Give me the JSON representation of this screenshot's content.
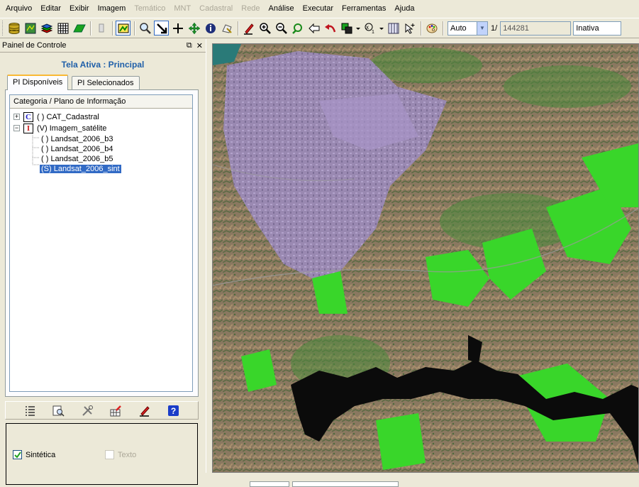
{
  "menu": {
    "items": [
      {
        "label": "Arquivo",
        "enabled": true
      },
      {
        "label": "Editar",
        "enabled": true
      },
      {
        "label": "Exibir",
        "enabled": true
      },
      {
        "label": "Imagem",
        "enabled": true
      },
      {
        "label": "Temático",
        "enabled": false
      },
      {
        "label": "MNT",
        "enabled": false
      },
      {
        "label": "Cadastral",
        "enabled": false
      },
      {
        "label": "Rede",
        "enabled": false
      },
      {
        "label": "Análise",
        "enabled": true
      },
      {
        "label": "Executar",
        "enabled": true
      },
      {
        "label": "Ferramentas",
        "enabled": true
      },
      {
        "label": "Ajuda",
        "enabled": true
      }
    ]
  },
  "toolbar": {
    "zoom_select_value": "Auto",
    "scale_prefix": "1/",
    "scale_value": "144281",
    "status_value": "Inativa"
  },
  "panel": {
    "title": "Painel de Controle",
    "active_screen": "Tela Ativa : Principal",
    "tabs": [
      "PI Disponíveis",
      "PI Selecionados"
    ],
    "tree_header": "Categoria / Plano de Informação",
    "tree": {
      "category1": {
        "expander": "+",
        "icon_letter": "C",
        "label": "( ) CAT_Cadastral"
      },
      "category2": {
        "expander": "−",
        "icon_letter": "I",
        "label": "(V) Imagem_satélite"
      },
      "items": [
        {
          "label": "( ) Landsat_2006_b3"
        },
        {
          "label": "( ) Landsat_2006_b4"
        },
        {
          "label": "( ) Landsat_2006_b5"
        },
        {
          "label": "(S) Landsat_2006_sint"
        }
      ]
    },
    "options": {
      "synthetic_label": "Sintética",
      "synthetic_checked": true,
      "text_label": "Texto",
      "text_checked": false
    }
  },
  "colors": {
    "selection": "#316ac5",
    "active_label": "#1f5fa9",
    "cat_c": "#1a1ac8",
    "cat_i": "#c81a1a"
  }
}
